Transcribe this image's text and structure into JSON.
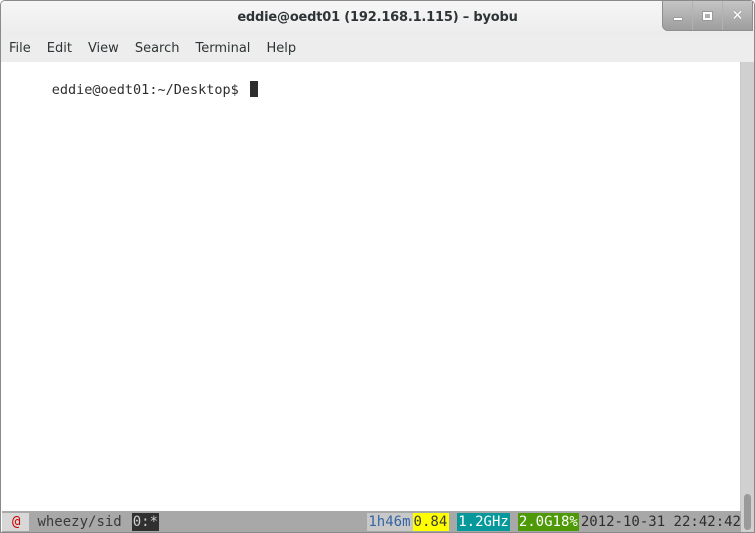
{
  "window": {
    "title": "eddie@oedt01 (192.168.1.115) – byobu",
    "controls": {
      "minimize_icon": "minimize-icon",
      "maximize_icon": "maximize-icon",
      "close_glyph": "✕"
    }
  },
  "menubar": {
    "items": [
      {
        "label": "File"
      },
      {
        "label": "Edit"
      },
      {
        "label": "View"
      },
      {
        "label": "Search"
      },
      {
        "label": "Terminal"
      },
      {
        "label": "Help"
      }
    ]
  },
  "terminal": {
    "prompt": "eddie@oedt01:~/Desktop$",
    "input": ""
  },
  "statusbar": {
    "logo": "@",
    "release": "wheezy/sid",
    "window": "0:*",
    "uptime": "1h46m",
    "load": "0.84",
    "cpu_freq": "1.2GHz",
    "memory": "2.0G18%",
    "datetime": "2012-10-31 22:42:42",
    "colors": {
      "logo": "#cc0000",
      "uptime": "#3465a4",
      "load_bg": "#ffff00",
      "cpu_bg": "#06989a",
      "mem_bg": "#4e9a06"
    }
  }
}
